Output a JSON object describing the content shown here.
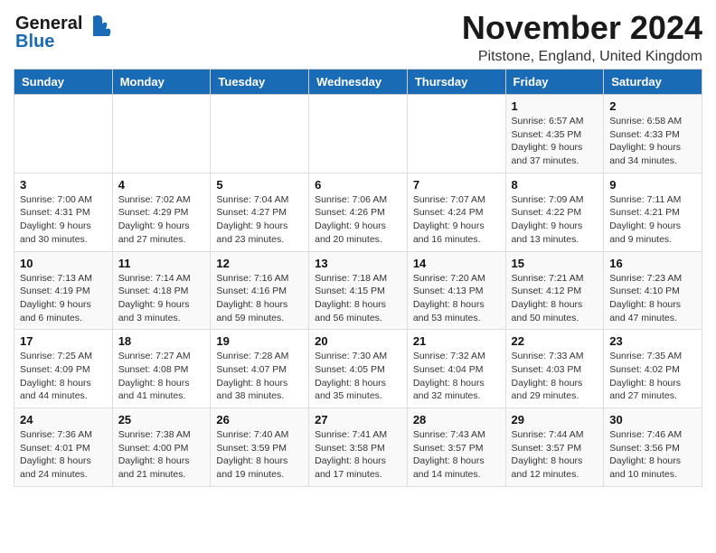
{
  "header": {
    "logo_line1": "General",
    "logo_line2": "Blue",
    "month_title": "November 2024",
    "location": "Pitstone, England, United Kingdom"
  },
  "weekdays": [
    "Sunday",
    "Monday",
    "Tuesday",
    "Wednesday",
    "Thursday",
    "Friday",
    "Saturday"
  ],
  "weeks": [
    [
      {
        "day": "",
        "info": ""
      },
      {
        "day": "",
        "info": ""
      },
      {
        "day": "",
        "info": ""
      },
      {
        "day": "",
        "info": ""
      },
      {
        "day": "",
        "info": ""
      },
      {
        "day": "1",
        "info": "Sunrise: 6:57 AM\nSunset: 4:35 PM\nDaylight: 9 hours\nand 37 minutes."
      },
      {
        "day": "2",
        "info": "Sunrise: 6:58 AM\nSunset: 4:33 PM\nDaylight: 9 hours\nand 34 minutes."
      }
    ],
    [
      {
        "day": "3",
        "info": "Sunrise: 7:00 AM\nSunset: 4:31 PM\nDaylight: 9 hours\nand 30 minutes."
      },
      {
        "day": "4",
        "info": "Sunrise: 7:02 AM\nSunset: 4:29 PM\nDaylight: 9 hours\nand 27 minutes."
      },
      {
        "day": "5",
        "info": "Sunrise: 7:04 AM\nSunset: 4:27 PM\nDaylight: 9 hours\nand 23 minutes."
      },
      {
        "day": "6",
        "info": "Sunrise: 7:06 AM\nSunset: 4:26 PM\nDaylight: 9 hours\nand 20 minutes."
      },
      {
        "day": "7",
        "info": "Sunrise: 7:07 AM\nSunset: 4:24 PM\nDaylight: 9 hours\nand 16 minutes."
      },
      {
        "day": "8",
        "info": "Sunrise: 7:09 AM\nSunset: 4:22 PM\nDaylight: 9 hours\nand 13 minutes."
      },
      {
        "day": "9",
        "info": "Sunrise: 7:11 AM\nSunset: 4:21 PM\nDaylight: 9 hours\nand 9 minutes."
      }
    ],
    [
      {
        "day": "10",
        "info": "Sunrise: 7:13 AM\nSunset: 4:19 PM\nDaylight: 9 hours\nand 6 minutes."
      },
      {
        "day": "11",
        "info": "Sunrise: 7:14 AM\nSunset: 4:18 PM\nDaylight: 9 hours\nand 3 minutes."
      },
      {
        "day": "12",
        "info": "Sunrise: 7:16 AM\nSunset: 4:16 PM\nDaylight: 8 hours\nand 59 minutes."
      },
      {
        "day": "13",
        "info": "Sunrise: 7:18 AM\nSunset: 4:15 PM\nDaylight: 8 hours\nand 56 minutes."
      },
      {
        "day": "14",
        "info": "Sunrise: 7:20 AM\nSunset: 4:13 PM\nDaylight: 8 hours\nand 53 minutes."
      },
      {
        "day": "15",
        "info": "Sunrise: 7:21 AM\nSunset: 4:12 PM\nDaylight: 8 hours\nand 50 minutes."
      },
      {
        "day": "16",
        "info": "Sunrise: 7:23 AM\nSunset: 4:10 PM\nDaylight: 8 hours\nand 47 minutes."
      }
    ],
    [
      {
        "day": "17",
        "info": "Sunrise: 7:25 AM\nSunset: 4:09 PM\nDaylight: 8 hours\nand 44 minutes."
      },
      {
        "day": "18",
        "info": "Sunrise: 7:27 AM\nSunset: 4:08 PM\nDaylight: 8 hours\nand 41 minutes."
      },
      {
        "day": "19",
        "info": "Sunrise: 7:28 AM\nSunset: 4:07 PM\nDaylight: 8 hours\nand 38 minutes."
      },
      {
        "day": "20",
        "info": "Sunrise: 7:30 AM\nSunset: 4:05 PM\nDaylight: 8 hours\nand 35 minutes."
      },
      {
        "day": "21",
        "info": "Sunrise: 7:32 AM\nSunset: 4:04 PM\nDaylight: 8 hours\nand 32 minutes."
      },
      {
        "day": "22",
        "info": "Sunrise: 7:33 AM\nSunset: 4:03 PM\nDaylight: 8 hours\nand 29 minutes."
      },
      {
        "day": "23",
        "info": "Sunrise: 7:35 AM\nSunset: 4:02 PM\nDaylight: 8 hours\nand 27 minutes."
      }
    ],
    [
      {
        "day": "24",
        "info": "Sunrise: 7:36 AM\nSunset: 4:01 PM\nDaylight: 8 hours\nand 24 minutes."
      },
      {
        "day": "25",
        "info": "Sunrise: 7:38 AM\nSunset: 4:00 PM\nDaylight: 8 hours\nand 21 minutes."
      },
      {
        "day": "26",
        "info": "Sunrise: 7:40 AM\nSunset: 3:59 PM\nDaylight: 8 hours\nand 19 minutes."
      },
      {
        "day": "27",
        "info": "Sunrise: 7:41 AM\nSunset: 3:58 PM\nDaylight: 8 hours\nand 17 minutes."
      },
      {
        "day": "28",
        "info": "Sunrise: 7:43 AM\nSunset: 3:57 PM\nDaylight: 8 hours\nand 14 minutes."
      },
      {
        "day": "29",
        "info": "Sunrise: 7:44 AM\nSunset: 3:57 PM\nDaylight: 8 hours\nand 12 minutes."
      },
      {
        "day": "30",
        "info": "Sunrise: 7:46 AM\nSunset: 3:56 PM\nDaylight: 8 hours\nand 10 minutes."
      }
    ]
  ]
}
